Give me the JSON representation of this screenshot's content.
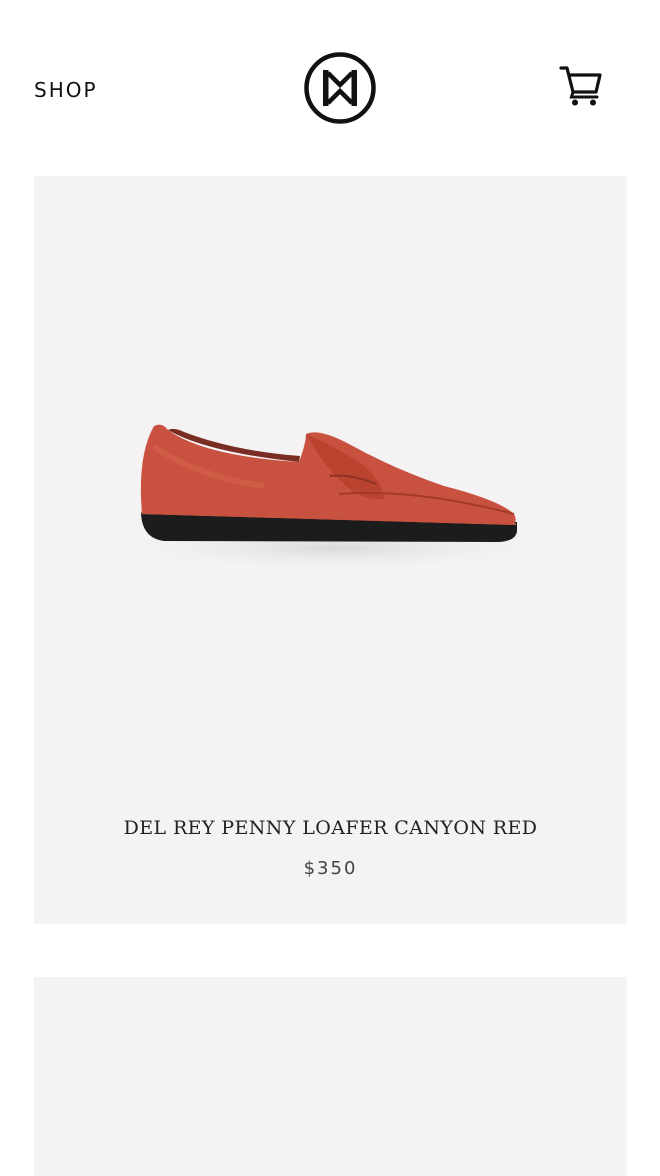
{
  "header": {
    "shop_label": "SHOP",
    "logo_icon": "brand-logo-icon",
    "cart_icon": "cart-icon"
  },
  "products": [
    {
      "name": "DEL REY PENNY LOAFER CANYON RED",
      "price": "$350",
      "image": "red-suede-penny-loafer"
    }
  ],
  "colors": {
    "card_background": "#f4f2f3",
    "shoe": "#c9513f",
    "sole": "#1c1c1c",
    "text": "#222222"
  }
}
